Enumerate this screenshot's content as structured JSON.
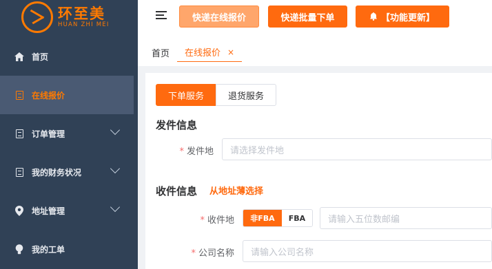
{
  "brand": {
    "name": "环至美",
    "subtitle": "HUAN ZHI MEI"
  },
  "sidebar": {
    "items": [
      {
        "label": "首页",
        "icon": "home-icon"
      },
      {
        "label": "在线报价",
        "icon": "document-icon",
        "active": true
      },
      {
        "label": "订单管理",
        "icon": "document-icon",
        "expandable": true
      },
      {
        "label": "我的财务状况",
        "icon": "document-icon",
        "expandable": true
      },
      {
        "label": "地址管理",
        "icon": "location-pin-icon",
        "expandable": true
      },
      {
        "label": "我的工单",
        "icon": "lightbulb-icon"
      }
    ]
  },
  "header": {
    "buttons": [
      {
        "label": "快递在线报价"
      },
      {
        "label": "快递批量下单"
      },
      {
        "label": "【功能更新】",
        "icon": "bell-icon"
      }
    ]
  },
  "tabs": [
    {
      "label": "首页"
    },
    {
      "label": "在线报价",
      "active": true,
      "close": "×"
    }
  ],
  "main": {
    "service_tabs": [
      {
        "label": "下单服务",
        "active": true
      },
      {
        "label": "退货服务"
      }
    ],
    "sender_section": {
      "title": "发件信息",
      "origin": {
        "label": "发件地",
        "required_mark": "*",
        "placeholder": "请选择发件地"
      }
    },
    "receiver_section": {
      "title": "收件信息",
      "address_book_link": "从地址薄选择",
      "destination": {
        "label": "收件地",
        "required_mark": "*",
        "options": [
          {
            "label": "非FBA",
            "selected": true
          },
          {
            "label": "FBA"
          }
        ],
        "zip_placeholder": "请输入五位数邮编"
      },
      "company": {
        "label": "公司名称",
        "required_mark": "*",
        "placeholder": "请输入公司名称"
      }
    }
  },
  "colors": {
    "accent": "#ff6a0f",
    "sidebar_bg": "#304156",
    "sidebar_active_bg": "#4a5a73"
  }
}
